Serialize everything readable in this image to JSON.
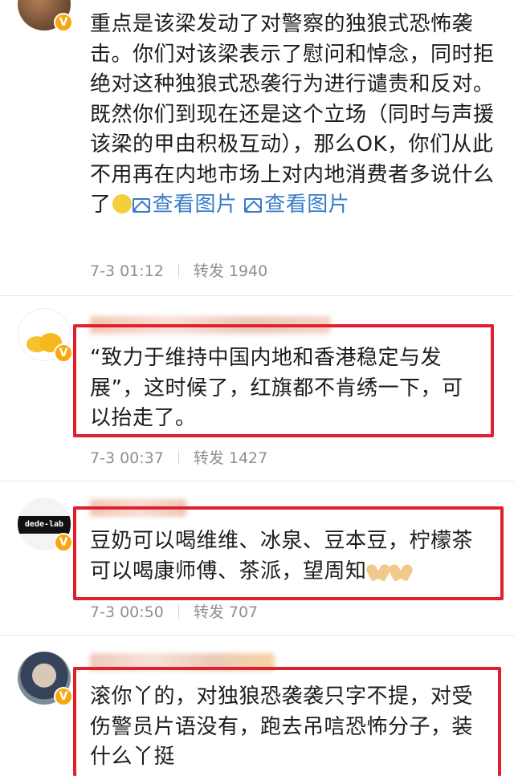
{
  "comments": [
    {
      "text": "重点是该梁发动了对警察的独狼式恐怖袭击。你们对该梁表示了慰问和悼念，同时拒绝对这种独狼式恐袭行为进行谴责和反对。既然你们到现在还是这个立场（同时与声援该梁的甲由积极互动），那么OK，你们从此不用再在内地市场上对内地消费者多说什么了",
      "links": [
        "查看图片",
        "查看图片"
      ],
      "time": "7-3 01:12",
      "repost": "转发 1940",
      "emoji": "thinking-emoji"
    },
    {
      "text": "“致力于维持中国内地和香港稳定与发展”，这时候了，红旗都不肯绣一下，可以抬走了。",
      "time": "7-3 00:37",
      "repost": "转发 1427"
    },
    {
      "avatar_text": "dede-lab",
      "text": "豆奶可以喝维维、冰泉、豆本豆，柠檬茶可以喝康师傅、茶派，望周知",
      "time": "7-3 00:50",
      "repost": "转发 707",
      "emoji": "folded-hands-emoji"
    },
    {
      "text": "滚你丫的，对独狼恐袭袭只字不提，对受伤警员片语没有，跑去吊唁恐怖分子，装什么丫挺"
    }
  ],
  "badge": "V",
  "colors": {
    "link": "#3a7bc8",
    "highlight": "#e0202a",
    "badge": "#f7a712",
    "meta": "#8f8f8f"
  }
}
